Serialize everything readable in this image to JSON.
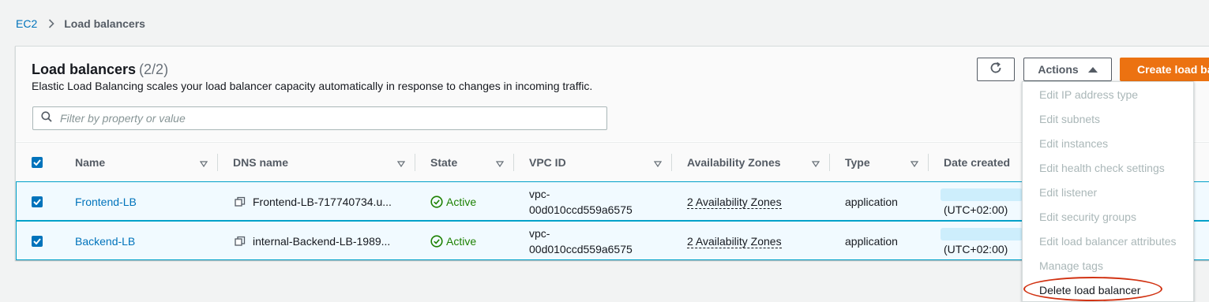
{
  "breadcrumb": {
    "root": "EC2",
    "current": "Load balancers"
  },
  "header": {
    "title": "Load balancers",
    "count": "(2/2)",
    "description": "Elastic Load Balancing scales your load balancer capacity automatically in response to changes in incoming traffic.",
    "filter_placeholder": "Filter by property or value",
    "actions_label": "Actions",
    "create_label": "Create load balancer"
  },
  "columns": {
    "name": "Name",
    "dns": "DNS name",
    "state": "State",
    "vpc": "VPC ID",
    "az": "Availability Zones",
    "type": "Type",
    "date": "Date created"
  },
  "rows": [
    {
      "name": "Frontend-LB",
      "dns": "Frontend-LB-717740734.u...",
      "state": "Active",
      "vpc_line1": "vpc-",
      "vpc_line2": "00d010ccd559a6575",
      "az": "2 Availability Zones",
      "type": "application",
      "date_tz": "(UTC+02:00)"
    },
    {
      "name": "Backend-LB",
      "dns": "internal-Backend-LB-1989...",
      "state": "Active",
      "vpc_line1": "vpc-",
      "vpc_line2": "00d010ccd559a6575",
      "az": "2 Availability Zones",
      "type": "application",
      "date_tz": "(UTC+02:00)"
    }
  ],
  "actions_menu": [
    {
      "label": "Edit IP address type",
      "enabled": false
    },
    {
      "label": "Edit subnets",
      "enabled": false
    },
    {
      "label": "Edit instances",
      "enabled": false
    },
    {
      "label": "Edit health check settings",
      "enabled": false
    },
    {
      "label": "Edit listener",
      "enabled": false
    },
    {
      "label": "Edit security groups",
      "enabled": false
    },
    {
      "label": "Edit load balancer attributes",
      "enabled": false
    },
    {
      "label": "Manage tags",
      "enabled": false
    },
    {
      "label": "Delete load balancer",
      "enabled": true
    }
  ],
  "colors": {
    "link": "#0073bb",
    "primary": "#ec7211",
    "active": "#1d8102",
    "selected_row_bg": "#f1faff",
    "selected_row_border": "#00a1c9",
    "highlight": "#d13212"
  },
  "icons": [
    "chevron-right-icon",
    "search-icon",
    "refresh-icon",
    "caret-up-icon",
    "sort-icon",
    "copy-icon",
    "check-circle-icon",
    "checkbox-checked-icon"
  ]
}
